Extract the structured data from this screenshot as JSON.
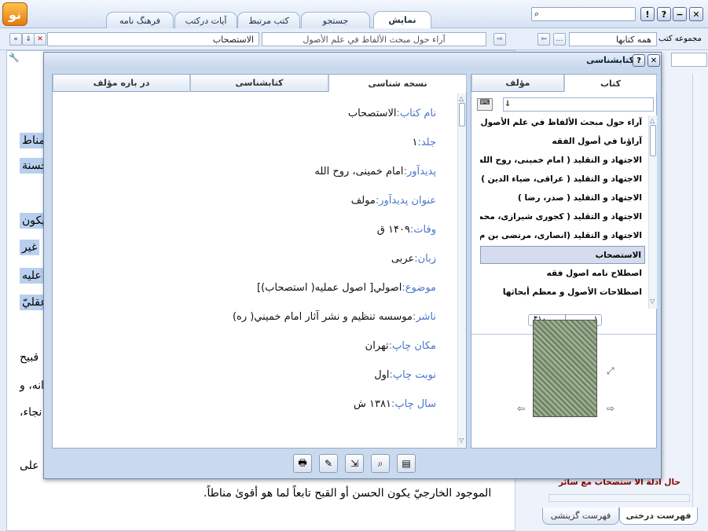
{
  "topbar": {
    "tabs": [
      "نمایش",
      "جستجو",
      "کتب مرتبط",
      "آیات درکتب",
      "فرهنگ نامه"
    ],
    "window_buttons": [
      "✕",
      "?",
      "!"
    ],
    "logo_text": "نو"
  },
  "addressbar": {
    "book_title": "آراء حول مبحث الألفاظ في علم الأصول",
    "current_book": "الاستصحاب",
    "group_label": "مجموعه کتب",
    "group_value": "همه کتابها"
  },
  "background": {
    "lines_right": [
      "مناط",
      "حسنة",
      "يكون",
      "غير",
      "عليه",
      "عقليّ",
      "قبيح",
      "انه، و",
      "نجاء،",
      "على"
    ],
    "bottom_line": "الموجود الخارجيّ يكون الحسن أو القبح تابعاً لما هو أقوىٰ مناطاً.",
    "tree_item": "حال ادلة الا ستصحاب مع سائر",
    "bottom_tabs": [
      "فهرست درختی",
      "فهرست گزینشی"
    ]
  },
  "dialog": {
    "title": "کتابشناسی",
    "left_tabs": [
      "نسخه شناسی",
      "کتابشناسی",
      "در باره مؤلف"
    ],
    "right_tabs": [
      "کتاب",
      "مؤلف"
    ],
    "fields": [
      {
        "label": "نام کتاب:",
        "value": "الاستصحاب"
      },
      {
        "label": "جلد:",
        "value": "۱"
      },
      {
        "label": "پدیدآور:",
        "value": "امام خمینی، روح الله"
      },
      {
        "label": "عنوان پدیدآور:",
        "value": "مولف"
      },
      {
        "label": "وفات:",
        "value": "۱۴۰۹ ق"
      },
      {
        "label": "زبان:",
        "value": "عربی"
      },
      {
        "label": "موضوع:",
        "value": "اصولي[ اصول عمليه( استصحاب)]"
      },
      {
        "label": "ناشر:",
        "value": "موسسه تنظیم و نشر آثار امام خمیني( ره)"
      },
      {
        "label": "مکان چاپ:",
        "value": "تهران"
      },
      {
        "label": "نوبت چاپ:",
        "value": "اول"
      },
      {
        "label": "سال چاپ:",
        "value": "۱۳۸۱ ش"
      }
    ],
    "book_list": [
      "آراء حول مبحث الألفاظ في علم الأصول",
      "آراؤنا في أصول الفقه",
      "الاجتهاد و التقليد ( امام خمینی، روح الله )",
      "الاجتهاد و التقليد ( عراقى، ضياء الدين )",
      "الاجتهاد و التقليد ( صدر، رضا )",
      "الاجتهاد و التقليد ( کجوری شيرازی، محمد ...",
      "الاجتهاد و التقليد (انصاری، مرتضى بن م ...",
      "الاستصحاب",
      "اصطلاح نامه اصول فقه",
      "اصطلاحات الأصول و معظم أبحاثها"
    ],
    "selected_index": 7,
    "pager": {
      "current": "۱",
      "total": "۴۱۰"
    }
  }
}
